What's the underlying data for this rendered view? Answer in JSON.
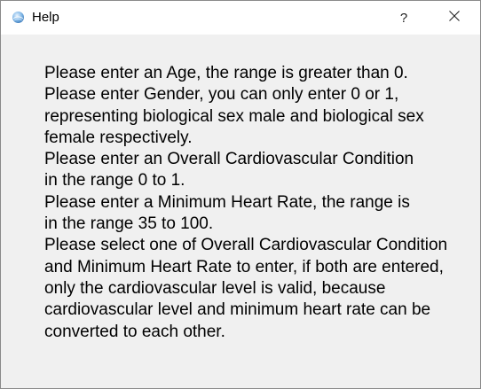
{
  "window": {
    "title": "Help",
    "help_button_label": "?",
    "app_icon": "app-globe-icon",
    "close_icon": "close-icon"
  },
  "help_text": {
    "lines": [
      "Please enter an Age, the range is greater than 0.",
      "Please enter Gender, you can only enter 0 or 1,",
      "representing biological sex male and biological sex",
      "female respectively.",
      "Please enter an Overall Cardiovascular Condition",
      "in the range 0 to 1.",
      "Please enter a Minimum Heart Rate, the range is",
      "in the range 35 to 100.",
      "Please select one of Overall Cardiovascular Condition",
      "and Minimum Heart Rate to enter, if both are entered,",
      "only the cardiovascular level is valid, because",
      "cardiovascular level and minimum heart rate can be",
      "converted to each other."
    ]
  },
  "colors": {
    "titlebar": "#ffffff",
    "body": "#f0f0f0",
    "text": "#000000"
  }
}
